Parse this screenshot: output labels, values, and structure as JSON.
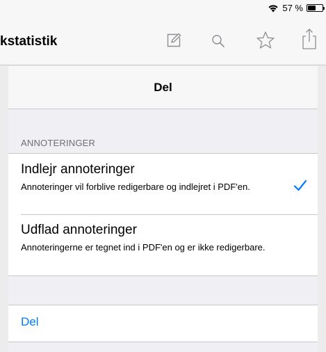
{
  "status_bar": {
    "wifi_icon": "wifi-icon",
    "battery_text": "57 %",
    "battery_level": 0.57,
    "battery_icon": "battery-icon"
  },
  "nav": {
    "title": "kstatistik",
    "icons": [
      "edit-icon",
      "search-icon",
      "star-icon",
      "share-icon"
    ]
  },
  "sheet": {
    "title": "Del",
    "section_header": "ANNOTERINGER",
    "options": [
      {
        "title": "Indlejr annoteringer",
        "subtitle": "Annoteringer vil forblive redigerbare og indlejret i PDF'en.",
        "selected": true
      },
      {
        "title": "Udflad annoteringer",
        "subtitle": "Annoteringerne er tegnet ind i PDF'en og er ikke redigerbare.",
        "selected": false
      }
    ],
    "action_label": "Del"
  },
  "colors": {
    "accent": "#007aff",
    "background": "#efeff4"
  }
}
